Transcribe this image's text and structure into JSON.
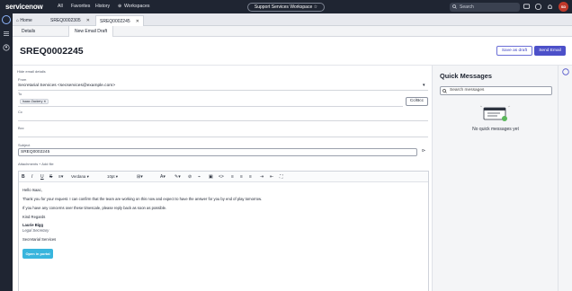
{
  "topnav": {
    "logo_text": "servicenow",
    "menu": [
      "All",
      "Favorites",
      "History",
      "Workspaces"
    ],
    "workspace_title": "Support Services Workspace",
    "search_placeholder": "Search",
    "avatar_initials": "SD"
  },
  "record_tabs": [
    {
      "label": "Home"
    },
    {
      "label": "SREQ0002305"
    },
    {
      "label": "SREQ0002245"
    }
  ],
  "sub_tabs": [
    "Details",
    "New Email Draft"
  ],
  "header": {
    "record_number": "SREQ0002245",
    "save_draft_label": "Save as draft",
    "send_label": "Send Email"
  },
  "email": {
    "hide_details_link": "Hide email details",
    "from_label": "From",
    "from_value": "Secretarial Services <secservices@example.com>",
    "to_label": "To",
    "to_chip": "Isaac Zackery",
    "cc_bcc_label": "Cc/Bcc",
    "cc_label": "Cc",
    "bcc_label": "Bcc",
    "subject_label": "Subject",
    "subject_value": "SREQ0002245",
    "attachments_label": "Attachments",
    "add_file_link": "Add file"
  },
  "toolbar": {
    "font": "Verdana",
    "size": "10pt"
  },
  "body": {
    "greeting": "Hello Isaac,",
    "line1": "Thank you for your request. I can confirm that the team are working on this now and expect to have the answer for you by end of play tomorrow.",
    "line2": "If you have any concerns over these timescale, please reply back as soon as possible.",
    "signoff": "Kind Regards",
    "sig_name": "Laurie Bigg",
    "sig_title": "Legal Secretary",
    "sig_dept": "Secretarial Services",
    "portal_button": "Open in portal"
  },
  "quick_messages": {
    "title": "Quick Messages",
    "search_placeholder": "Search messages",
    "empty_text": "No quick messages yet"
  },
  "colors": {
    "nav_bg": "#1f2532",
    "accent": "#4c50c9",
    "portal_button": "#38b5dd"
  }
}
